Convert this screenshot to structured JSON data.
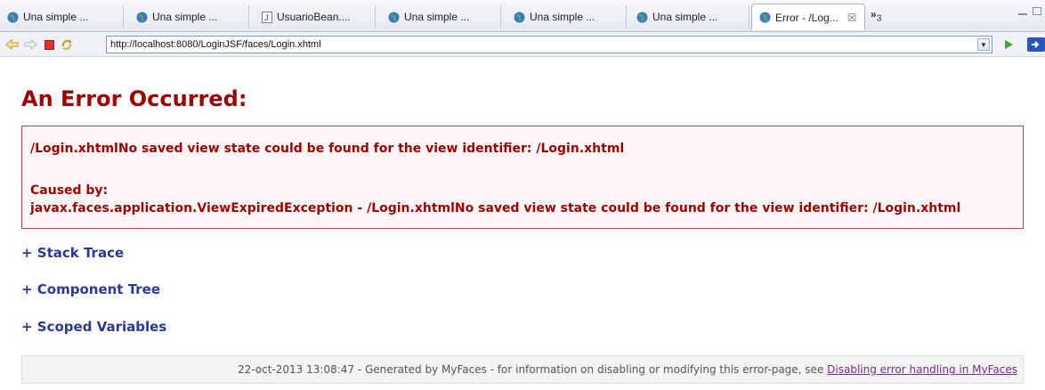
{
  "tabs": [
    {
      "label": "Una simple ...",
      "icon": "globe-icon"
    },
    {
      "label": "Una simple ...",
      "icon": "globe-icon"
    },
    {
      "label": "UsuarioBean....",
      "icon": "java-file-icon"
    },
    {
      "label": "Una simple ...",
      "icon": "globe-icon"
    },
    {
      "label": "Una simple ...",
      "icon": "globe-icon"
    },
    {
      "label": "Una simple ...",
      "icon": "globe-icon"
    },
    {
      "label": "Error - /Log...",
      "icon": "globe-icon",
      "active": true,
      "close": "☒"
    }
  ],
  "tab_overflow": {
    "symbol": "»",
    "count": "3"
  },
  "nav": {
    "url": "http://localhost:8080/LoginJSF/faces/Login.xhtml",
    "dropdown": "▼"
  },
  "page": {
    "title": "An Error Occurred:",
    "error_message": "/Login.xhtmlNo saved view state could be found for the view identifier: /Login.xhtml",
    "caused_by_label": "Caused by:",
    "caused_by_message": "javax.faces.application.ViewExpiredException - /Login.xhtmlNo saved view state could be found for the view identifier: /Login.xhtml",
    "links": {
      "stack_trace": "+ Stack Trace",
      "component_tree": "+ Component Tree",
      "scoped_variables": "+ Scoped Variables"
    },
    "footer_text": "22-oct-2013 13:08:47 - Generated by MyFaces - for information on disabling or modifying this error-page, see ",
    "footer_link": "Disabling error handling in MyFaces"
  },
  "colors": {
    "error_red": "#990000",
    "link_blue": "#2a3b8f",
    "footer_link": "#7a2a8c"
  }
}
